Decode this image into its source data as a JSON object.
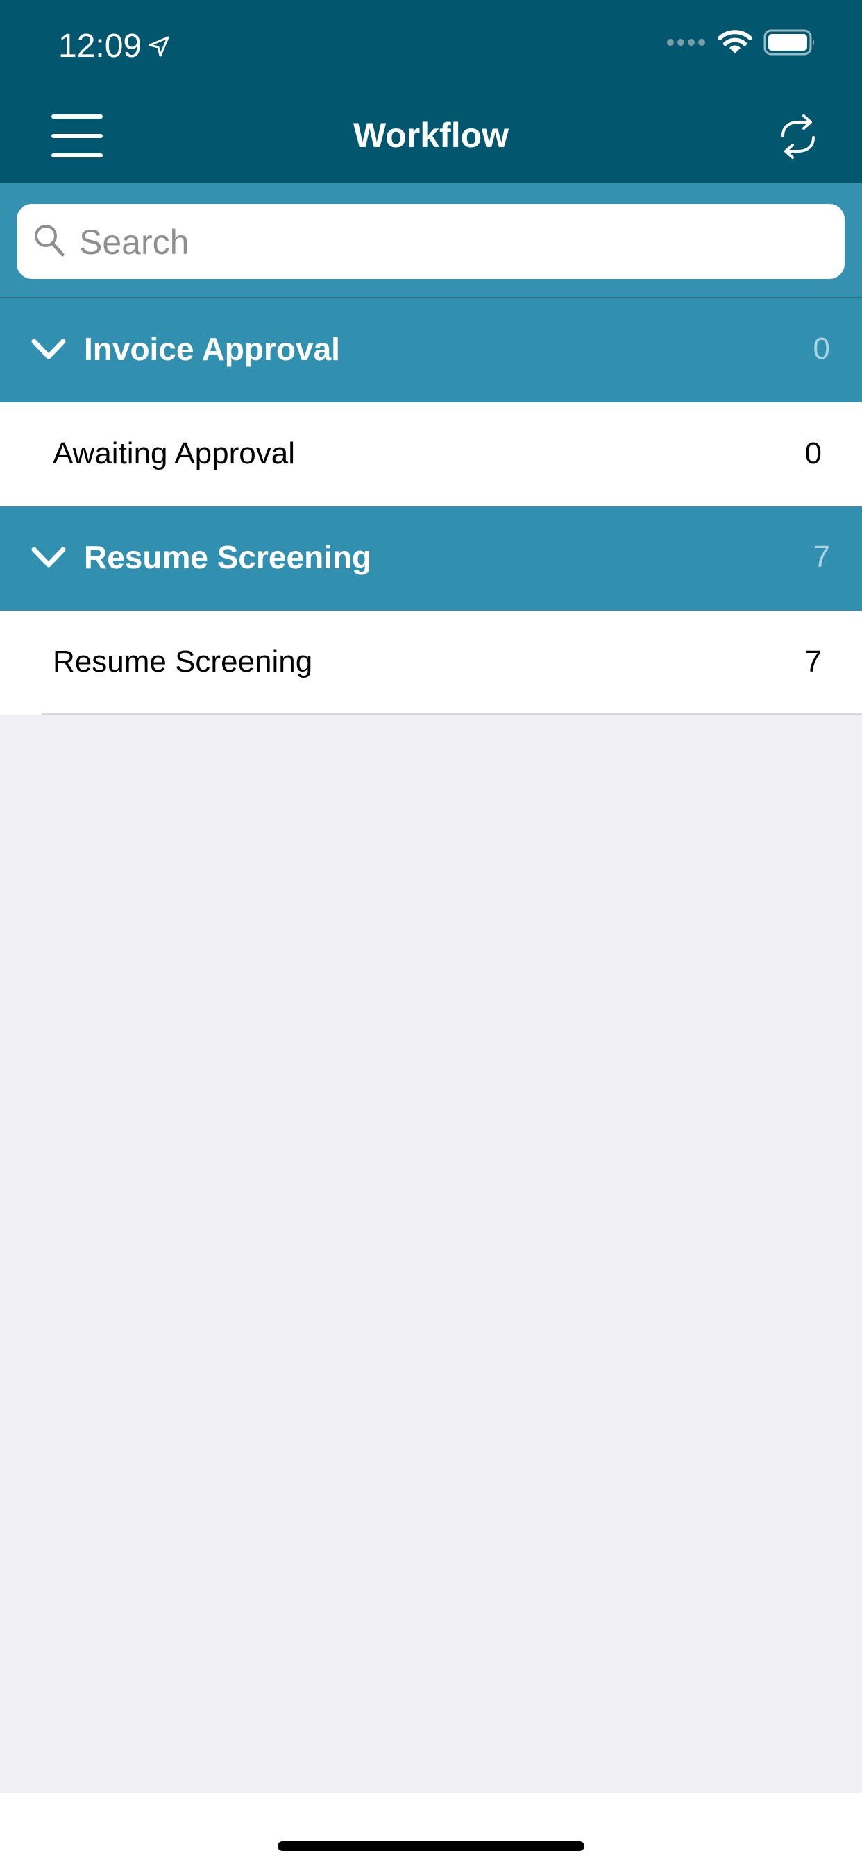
{
  "status_bar": {
    "time": "12:09",
    "icons": [
      "location-arrow-icon",
      "signal-dots-icon",
      "wifi-icon",
      "battery-icon"
    ]
  },
  "nav": {
    "title": "Workflow",
    "left_icon": "hamburger-menu-icon",
    "right_icon": "sync-icon"
  },
  "search": {
    "placeholder": "Search",
    "value": ""
  },
  "sections": [
    {
      "title": "Invoice Approval",
      "count": "0",
      "expanded": true,
      "items": [
        {
          "label": "Awaiting Approval",
          "count": "0"
        }
      ]
    },
    {
      "title": "Resume Screening",
      "count": "7",
      "expanded": true,
      "items": [
        {
          "label": "Resume Screening",
          "count": "7"
        }
      ]
    }
  ],
  "colors": {
    "nav_bar": "#02566e",
    "section_header": "#3190b0",
    "background": "#efeff4"
  }
}
